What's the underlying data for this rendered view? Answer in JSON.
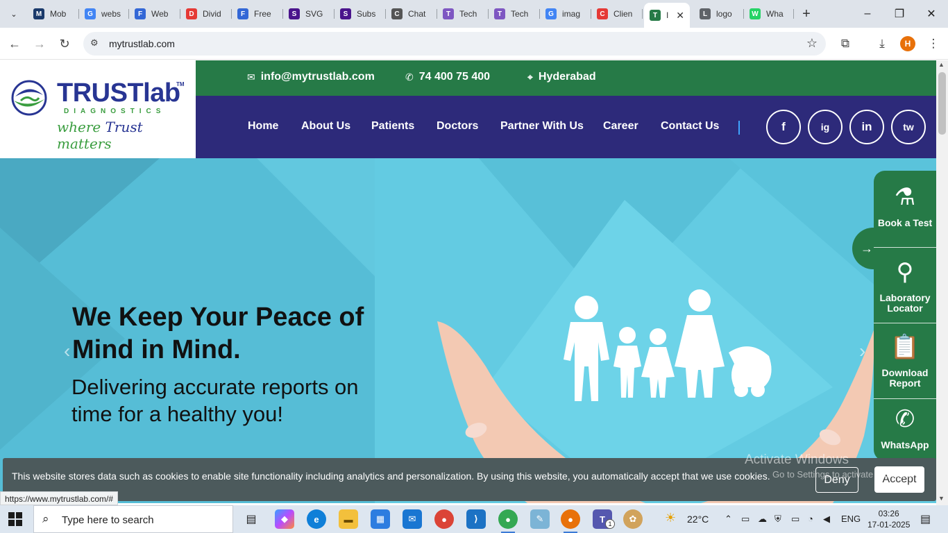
{
  "browser": {
    "tabs": [
      {
        "title": "Mob",
        "favicon_color": "#1a3a6b",
        "icon": "M"
      },
      {
        "title": "webs",
        "favicon_color": "#4285f4",
        "icon": "G"
      },
      {
        "title": "Web",
        "favicon_color": "#3367d6",
        "icon": "F"
      },
      {
        "title": "Divid",
        "favicon_color": "#e53935",
        "icon": "D"
      },
      {
        "title": "Free",
        "favicon_color": "#3367d6",
        "icon": "F"
      },
      {
        "title": "SVG",
        "favicon_color": "#4a148c",
        "icon": "S"
      },
      {
        "title": "Subs",
        "favicon_color": "#4a148c",
        "icon": "S"
      },
      {
        "title": "Chat",
        "favicon_color": "#555555",
        "icon": "C"
      },
      {
        "title": "Tech",
        "favicon_color": "#7e57c2",
        "icon": "T"
      },
      {
        "title": "Tech",
        "favicon_color": "#7e57c2",
        "icon": "T"
      },
      {
        "title": "imag",
        "favicon_color": "#4285f4",
        "icon": "G"
      },
      {
        "title": "Clien",
        "favicon_color": "#e53935",
        "icon": "C"
      },
      {
        "title": "I",
        "favicon_color": "#267a47",
        "icon": "T"
      },
      {
        "title": "logo",
        "favicon_color": "#5f6368",
        "icon": "L"
      },
      {
        "title": "Wha",
        "favicon_color": "#25d366",
        "icon": "W"
      }
    ],
    "url": "mytrustlab.com",
    "profile_initial": "H",
    "status_url": "https://www.mytrustlab.com/#"
  },
  "site": {
    "logo": {
      "title": "TRUSTlab",
      "tm": "TM",
      "subtitle": "DIAGNOSTICS",
      "tagline_a": "where ",
      "tagline_b": "Trust",
      "tagline_c": " matters"
    },
    "contacts": {
      "email": "info@mytrustlab.com",
      "phone": "74 400 75 400",
      "location": "Hyderabad"
    },
    "nav": [
      "Home",
      "About Us",
      "Patients",
      "Doctors",
      "Partner With Us",
      "Career",
      "Contact Us"
    ],
    "social": [
      "f",
      "ig",
      "in",
      "tw"
    ],
    "hero": {
      "heading": "We Keep Your Peace of Mind in Mind.",
      "subheading": "Delivering accurate reports on time for a healthy you!"
    },
    "side_panel": [
      {
        "label": "Book a Test",
        "icon": "test-tube-icon"
      },
      {
        "label": "Laboratory Locator",
        "icon": "map-pin-icon"
      },
      {
        "label": "Download Report",
        "icon": "clipboard-icon"
      },
      {
        "label": "WhatsApp",
        "icon": "whatsapp-icon"
      }
    ],
    "cookie": {
      "text": "This website stores data such as cookies to enable site functionality including analytics and personalization. By using this website, you automatically accept that we use cookies.",
      "deny": "Deny",
      "accept": "Accept"
    },
    "watermark": {
      "line1": "Activate Windows",
      "line2": "Go to Settings to activate Windows."
    },
    "colors": {
      "green": "#267a47",
      "navy": "#2d2a7a",
      "hero": "#5dc6dd"
    }
  },
  "taskbar": {
    "search_placeholder": "Type here to search",
    "weather": "22°C",
    "language": "ENG",
    "time": "03:26",
    "date": "17-01-2025",
    "teams_badge": "1"
  }
}
